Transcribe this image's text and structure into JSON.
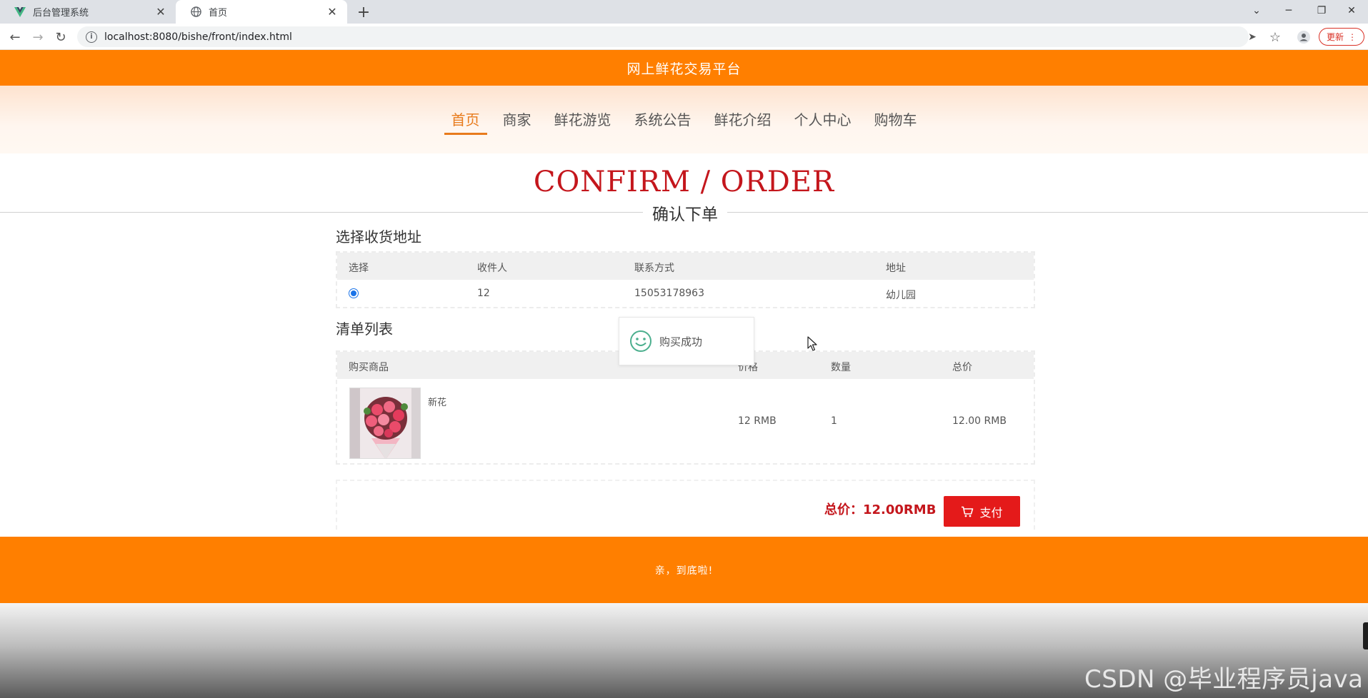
{
  "browser": {
    "tabs": [
      {
        "title": "后台管理系统",
        "icon": "vue-logo-icon"
      },
      {
        "title": "首页",
        "icon": "globe-icon"
      }
    ],
    "url": "localhost:8080/bishe/front/index.html",
    "update_label": "更新"
  },
  "site": {
    "brand": "网上鲜花交易平台",
    "nav": [
      "首页",
      "商家",
      "鲜花游览",
      "系统公告",
      "鲜花介绍",
      "个人中心",
      "购物车"
    ],
    "active_nav": "首页"
  },
  "page": {
    "title": "CONFIRM / ORDER",
    "subtitle": "确认下单"
  },
  "address_section": {
    "label": "选择收货地址",
    "columns": [
      "选择",
      "收件人",
      "联系方式",
      "地址"
    ],
    "rows": [
      {
        "selected": true,
        "recipient": "12",
        "phone": "15053178963",
        "address": "幼儿园"
      }
    ]
  },
  "order_section": {
    "label": "清单列表",
    "columns": [
      "购买商品",
      "价格",
      "数量",
      "总价"
    ],
    "items": [
      {
        "name": "新花",
        "price": "12 RMB",
        "quantity": "1",
        "total": "12.00 RMB"
      }
    ]
  },
  "summary": {
    "total_text": "总价：12.00RMB",
    "pay_label": "支付"
  },
  "toast": {
    "message": "购买成功",
    "icon": "smile-icon"
  },
  "footer": {
    "text": "亲，到底啦!"
  },
  "watermark": "CSDN @毕业程序员java",
  "colors": {
    "brand_orange": "#ff7f00",
    "title_red": "#c4161c",
    "pay_red": "#e41a1a",
    "nav_active": "#e87b1c"
  }
}
